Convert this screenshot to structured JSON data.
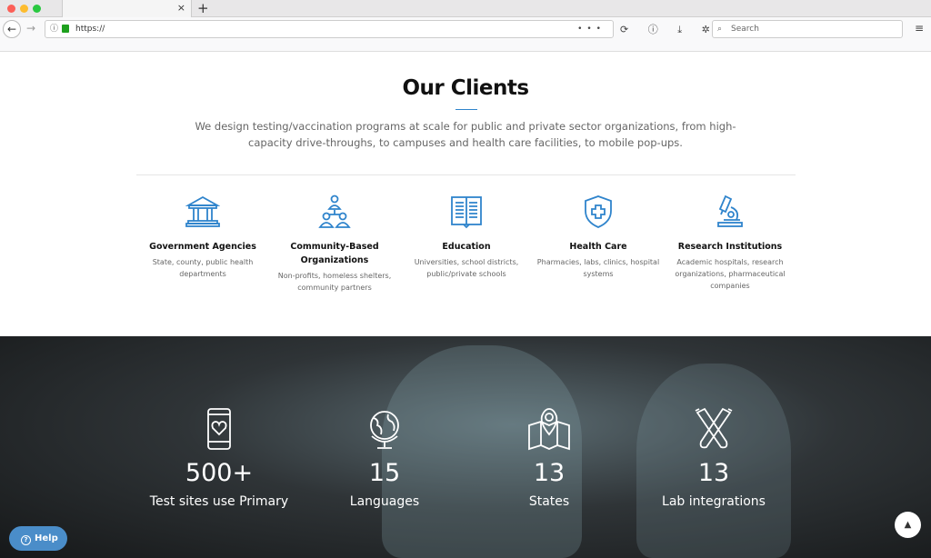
{
  "browser": {
    "url": "https://",
    "search_placeholder": "Search",
    "tab_close": "×",
    "new_tab": "+",
    "back": "←",
    "forward": "→",
    "more": "•••",
    "hamburger": "≡",
    "search_icon": "⌕",
    "info_icon": "ⓘ",
    "tools": "⟳ ⓘ ⤓ ✲ ⎙"
  },
  "clients": {
    "title": "Our Clients",
    "intro": "We design testing/vaccination programs at scale for public and private sector organizations, from high-capacity drive-throughs, to campuses and health care facilities, to mobile pop-ups.",
    "accent": "#2f84cc",
    "items": [
      {
        "icon": "government-building-icon",
        "title": "Government Agencies",
        "desc": "State, county, public health departments"
      },
      {
        "icon": "community-organization-icon",
        "title": "Community-Based Organizations",
        "desc": "Non-profits, homeless shelters, community partners"
      },
      {
        "icon": "book-icon",
        "title": "Education",
        "desc": "Universities, school districts, public/private schools"
      },
      {
        "icon": "shield-cross-icon",
        "title": "Health Care",
        "desc": "Pharmacies, labs, clinics, hospital systems"
      },
      {
        "icon": "microscope-icon",
        "title": "Research Institutions",
        "desc": "Academic hospitals, research organizations, pharmaceutical companies"
      }
    ]
  },
  "stats": [
    {
      "icon": "phone-heart-icon",
      "value": "500+",
      "label": "Test sites use Primary"
    },
    {
      "icon": "globe-icon",
      "value": "15",
      "label": "Languages"
    },
    {
      "icon": "map-pin-icon",
      "value": "13",
      "label": "States"
    },
    {
      "icon": "test-tubes-icon",
      "value": "13",
      "label": "Lab integrations"
    }
  ],
  "help": {
    "label": "Help",
    "icon": "?"
  },
  "scroll_top": "▲"
}
